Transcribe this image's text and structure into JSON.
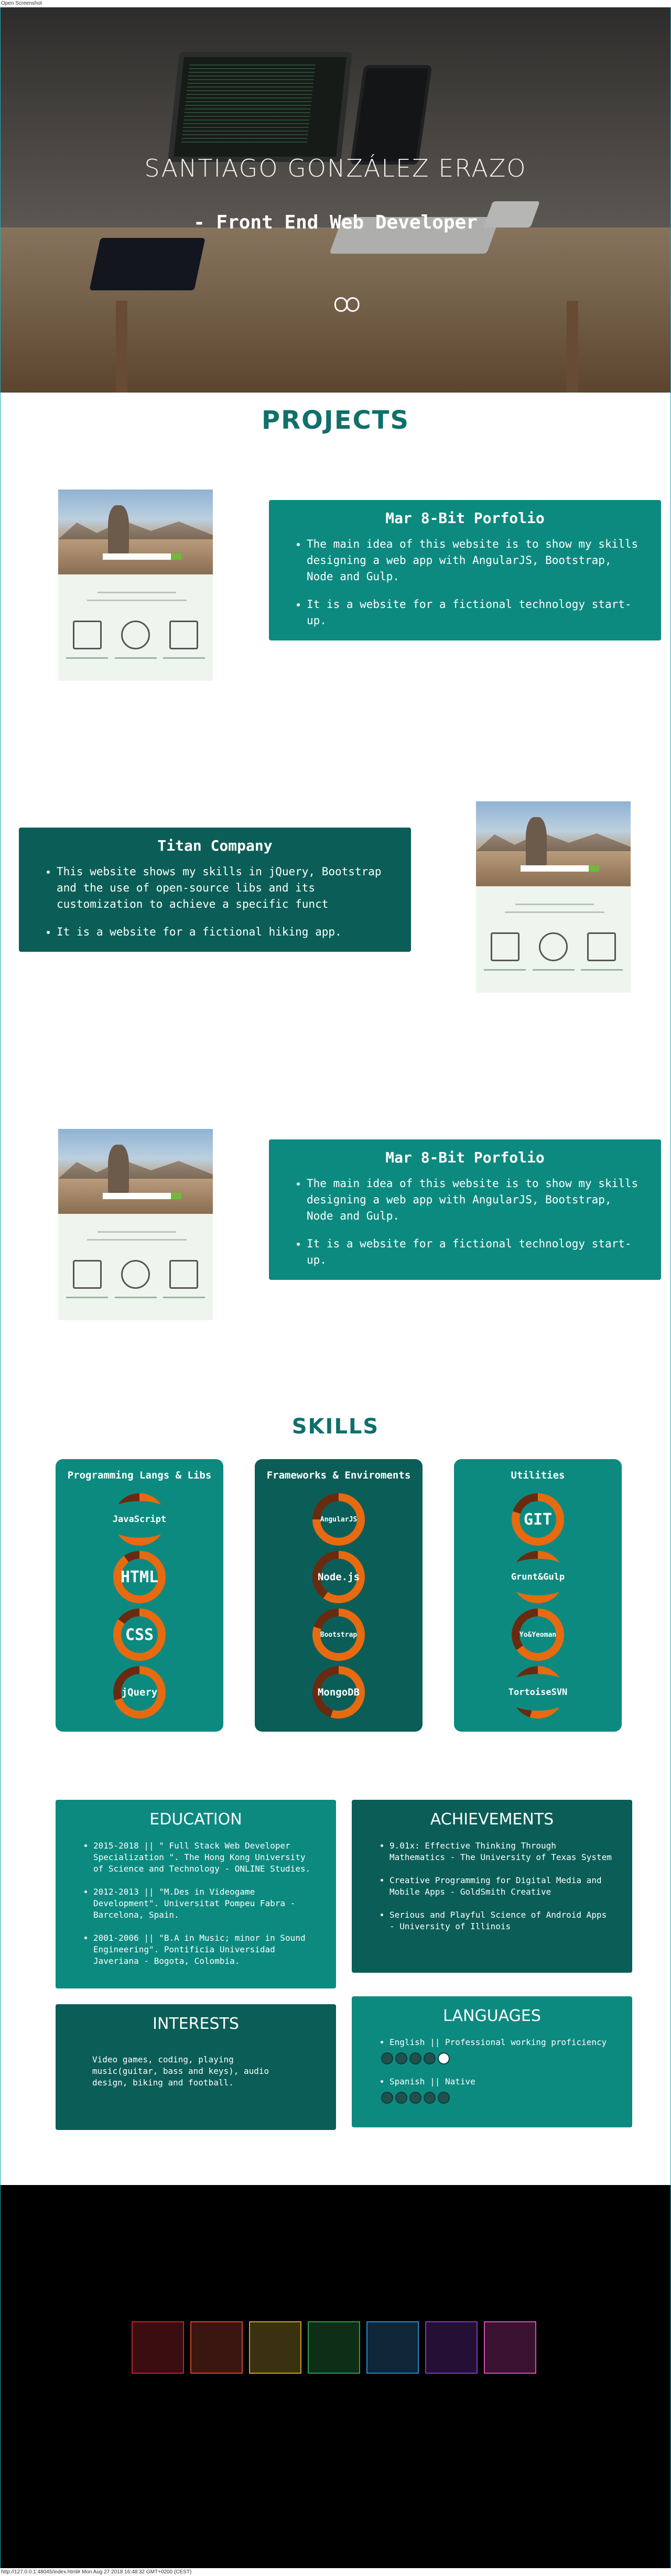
{
  "browser": {
    "top_label": "Open Screenshot",
    "bottom_label": "http://127.0.0.1:48045/index.html# Mon Aug 27 2018 16:48:32 GMT+0200 (CEST)"
  },
  "hero": {
    "name": "SANTIAGO GONZÁLEZ ERAZO",
    "role": "- Front End Web Developer",
    "scroll_icon": "mouse-scroll-icon"
  },
  "projects": {
    "title": "PROJECTS",
    "items": [
      {
        "name": "Mar 8-Bit Porfolio",
        "bullets": [
          "The main idea of this website is to show my skills designing a web app with AngularJS, Bootstrap, Node and Gulp.",
          "It is a website for a fictional technology start-up."
        ]
      },
      {
        "name": "Titan Company",
        "bullets": [
          "This website shows my skills in jQuery, Bootstrap and the use of open-source libs and its customization to achieve a specific funct",
          "It is a website for a fictional hiking app."
        ]
      },
      {
        "name": "Mar 8-Bit Porfolio",
        "bullets": [
          "The main idea of this website is to show my skills designing a web app with AngularJS, Bootstrap, Node and Gulp.",
          "It is a website for a fictional technology start-up."
        ]
      }
    ]
  },
  "skills": {
    "title": "SKILLS",
    "groups": [
      {
        "title": "Programming Langs & Libs",
        "items": [
          {
            "label": "JavaScript",
            "level": 0.85
          },
          {
            "label": "HTML",
            "level": 0.9
          },
          {
            "label": "CSS",
            "level": 0.85
          },
          {
            "label": "jQuery",
            "level": 0.7
          }
        ]
      },
      {
        "title": "Frameworks & Enviroments",
        "items": [
          {
            "label": "AngularJS",
            "level": 0.75
          },
          {
            "label": "Node.js",
            "level": 0.6
          },
          {
            "label": "Bootstrap",
            "level": 0.8
          },
          {
            "label": "MongoDB",
            "level": 0.55
          }
        ]
      },
      {
        "title": "Utilities",
        "items": [
          {
            "label": "GIT",
            "level": 0.8
          },
          {
            "label": "Grunt&Gulp",
            "level": 0.7
          },
          {
            "label": "Yo&Yeoman",
            "level": 0.65
          },
          {
            "label": "TortoiseSVN",
            "level": 0.55
          }
        ]
      }
    ]
  },
  "education": {
    "title": "EDUCATION",
    "items": [
      "2015-2018 || \" Full Stack Web Developer Specialization \". The Hong Kong University of Science and Technology - ONLINE Studies.",
      "2012-2013 || \"M.Des in Videogame Development\". Universitat Pompeu Fabra - Barcelona, Spain.",
      "2001-2006 || \"B.A in Music; minor in Sound Engineering\". Pontificia Universidad Javeriana - Bogota, Colombia."
    ]
  },
  "achievements": {
    "title": "ACHIEVEMENTS",
    "items": [
      "9.01x: Effective Thinking Through Mathematics - The University of Texas System",
      "Creative Programming for Digital Media and Mobile Apps - GoldSmith Creative",
      "Serious and Playful Science of Android Apps - University of Illinois"
    ]
  },
  "interests": {
    "title": "INTERESTS",
    "text": "Video games, coding, playing music(guitar, bass and keys), audio design, biking and football."
  },
  "languages": {
    "title": "LANGUAGES",
    "items": [
      {
        "label": "English || Professional working proficiency",
        "rating": 4,
        "max": 5
      },
      {
        "label": "Spanish || Native",
        "rating": 5,
        "max": 5
      }
    ]
  },
  "footer": {
    "squares": [
      {
        "color": "#b8242a",
        "fill": "#3a0e10"
      },
      {
        "color": "#c8452c",
        "fill": "#3b1610"
      },
      {
        "color": "#c9a02a",
        "fill": "#3a3110"
      },
      {
        "color": "#2d9a4c",
        "fill": "#0f2e18"
      },
      {
        "color": "#2a88c6",
        "fill": "#0e2638"
      },
      {
        "color": "#7b3bb0",
        "fill": "#241034"
      },
      {
        "color": "#d14fb0",
        "fill": "#3a1231"
      }
    ]
  },
  "colors": {
    "accent_teal": "#0d8a80",
    "dark_teal": "#0b5e57",
    "skill_ring": "#e86a10",
    "skill_ring_rest": "#6a2a10"
  }
}
